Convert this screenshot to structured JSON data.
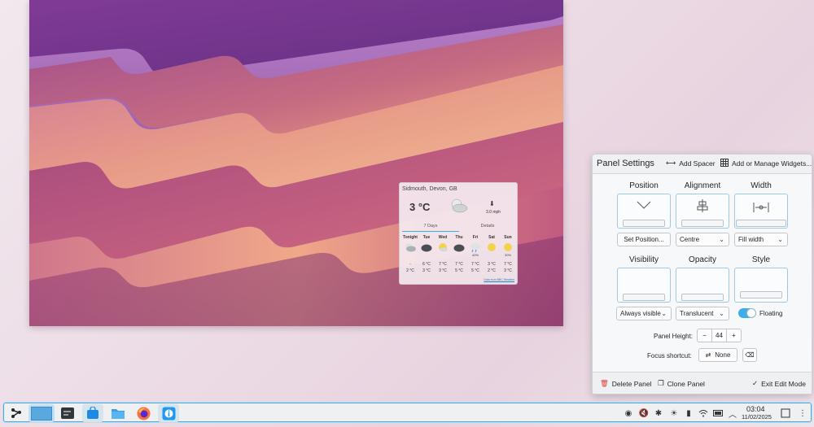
{
  "weather": {
    "location": "Sidmouth, Devon, GB",
    "temperature": "3 °C",
    "wind": "3.0 mph",
    "tabs": [
      "7 Days",
      "Details"
    ],
    "days": [
      {
        "name": "Tonight",
        "prob": "",
        "hi": "-",
        "lo": "2 °C",
        "icon": "cloudy-night-icon"
      },
      {
        "name": "Tue",
        "prob": "",
        "hi": "6 °C",
        "lo": "3 °C",
        "icon": "dark-cloud-icon"
      },
      {
        "name": "Wed",
        "prob": "",
        "hi": "7 °C",
        "lo": "3 °C",
        "icon": "sun-cloud-icon"
      },
      {
        "name": "Thu",
        "prob": "",
        "hi": "7 °C",
        "lo": "5 °C",
        "icon": "dark-cloud-icon"
      },
      {
        "name": "Fri",
        "prob": "40%",
        "hi": "7 °C",
        "lo": "5 °C",
        "icon": "rain-cloud-icon"
      },
      {
        "name": "Sat",
        "prob": "",
        "hi": "3 °C",
        "lo": "2 °C",
        "icon": "sun-icon"
      },
      {
        "name": "Sun",
        "prob": "30%",
        "hi": "7 °C",
        "lo": "3 °C",
        "icon": "sun-icon"
      }
    ],
    "credit": "Data from BBC Weather"
  },
  "panel_settings": {
    "title": "Panel Settings",
    "add_spacer": "Add Spacer",
    "add_widgets": "Add or Manage Widgets...",
    "position_title": "Position",
    "alignment_title": "Alignment",
    "width_title": "Width",
    "set_position": "Set Position...",
    "alignment_value": "Centre",
    "width_value": "Fill width",
    "visibility_title": "Visibility",
    "opacity_title": "Opacity",
    "style_title": "Style",
    "visibility_value": "Always visible",
    "opacity_value": "Translucent",
    "floating_label": "Floating",
    "panel_height_label": "Panel Height:",
    "panel_height_value": "44",
    "focus_shortcut_label": "Focus shortcut:",
    "focus_shortcut_value": "None",
    "delete_panel": "Delete Panel",
    "clone_panel": "Clone Panel",
    "exit_edit_mode": "Exit Edit Mode"
  },
  "taskbar": {
    "time": "03:04",
    "date": "11/02/2025"
  },
  "colors": {
    "accent": "#3daee9"
  }
}
